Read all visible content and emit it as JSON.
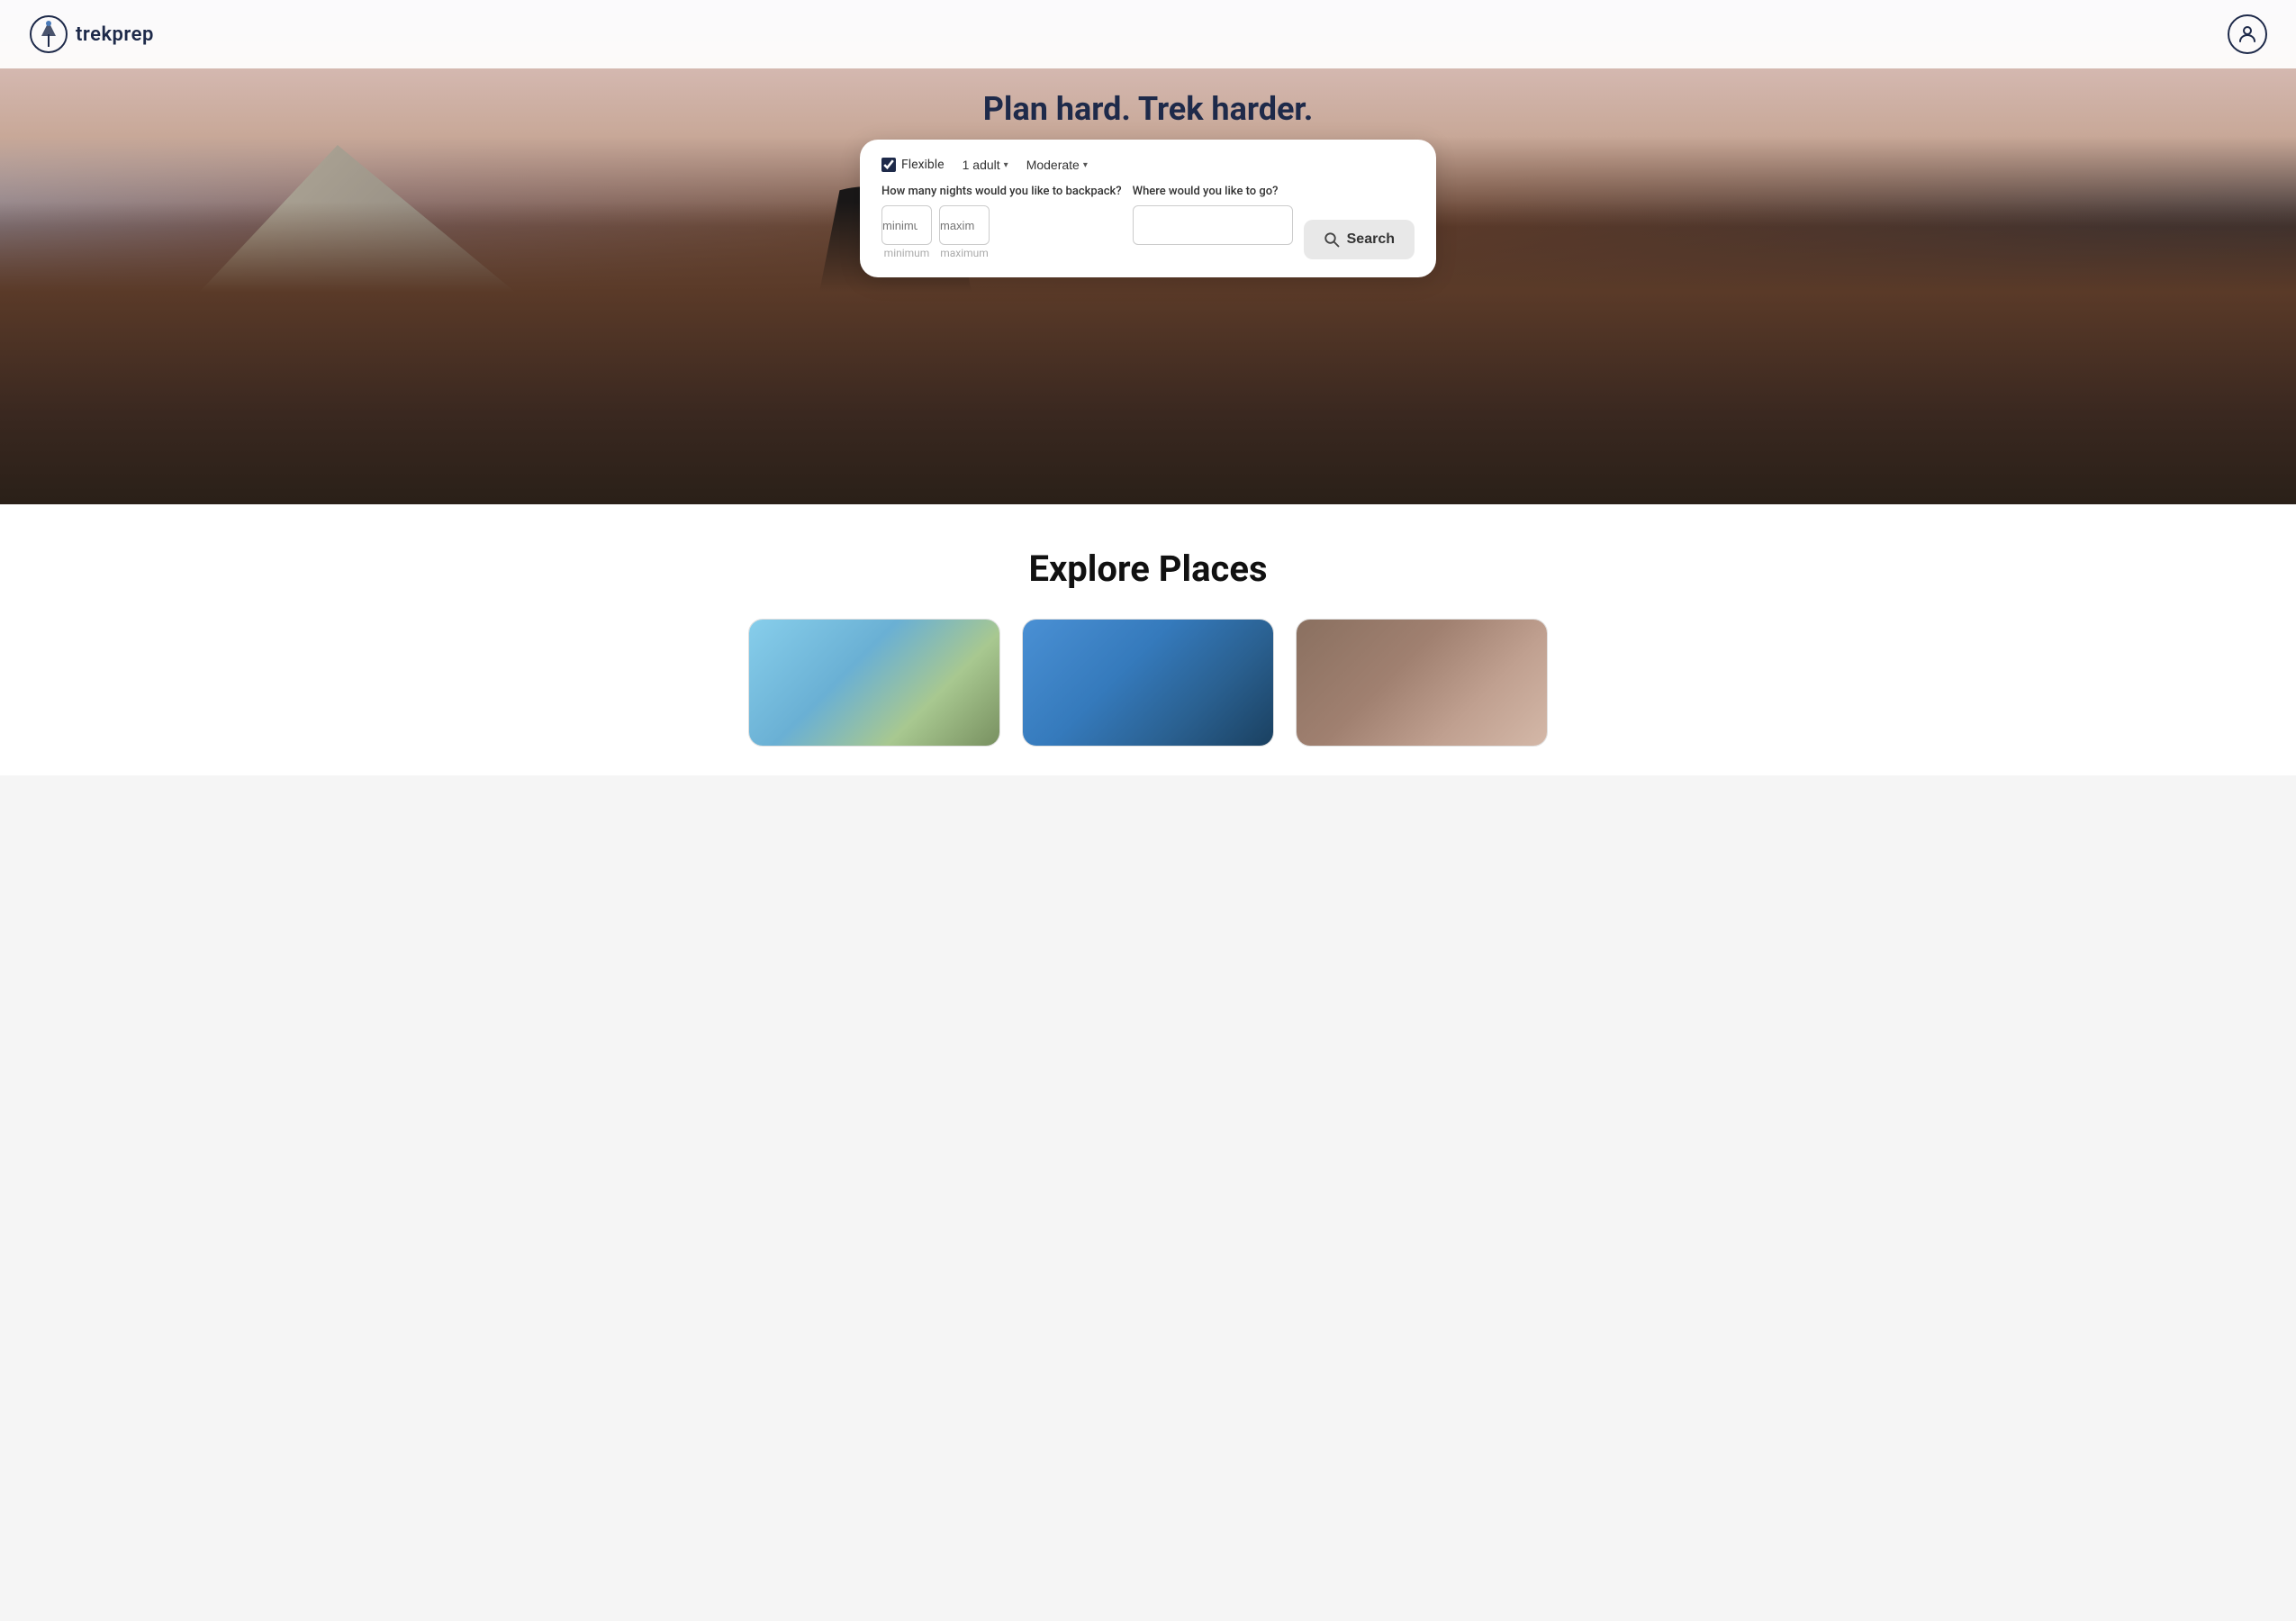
{
  "brand": {
    "name": "trekprep",
    "logo_alt": "TrekPrep Logo"
  },
  "hero": {
    "tagline": "Plan hard. Trek harder."
  },
  "search": {
    "flexible_label": "Flexible",
    "flexible_checked": true,
    "adults_label": "1 adult",
    "difficulty_label": "Moderate",
    "nights_question": "How many nights would you like to backpack?",
    "minimum_placeholder": "minimum",
    "maximum_placeholder": "maximum",
    "destination_question": "Where would you like to go?",
    "destination_placeholder": "",
    "search_button_label": "Search"
  },
  "explore": {
    "title": "Explore Places",
    "cards": [
      {
        "id": 1,
        "style": "card-img-1"
      },
      {
        "id": 2,
        "style": "card-img-2"
      },
      {
        "id": 3,
        "style": "card-img-3"
      }
    ]
  },
  "icons": {
    "search": "🔍",
    "user": "👤",
    "chevron_down": "▾"
  }
}
